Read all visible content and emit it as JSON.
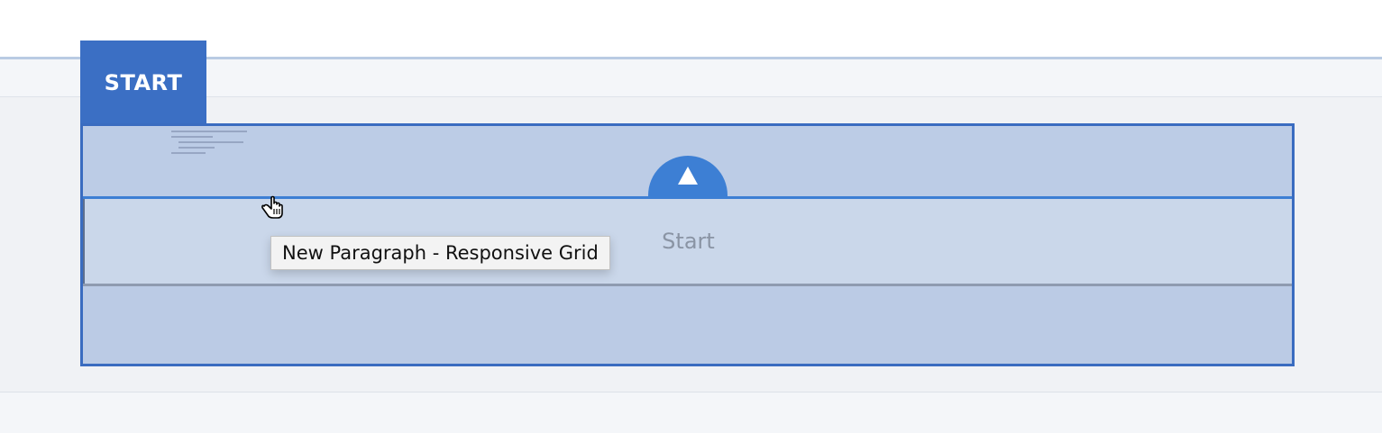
{
  "tab": {
    "label": "START"
  },
  "component": {
    "placeholder_label": "Start",
    "collapse_icon": "triangle-up-icon"
  },
  "tooltip": {
    "text": "New Paragraph - Responsive Grid"
  },
  "cursor": {
    "icon": "hand-pointer-icon"
  },
  "colors": {
    "accent": "#3b6fc4",
    "button": "#3d7fd4",
    "frame": "#3a6cc0",
    "region": "#bccce6"
  }
}
